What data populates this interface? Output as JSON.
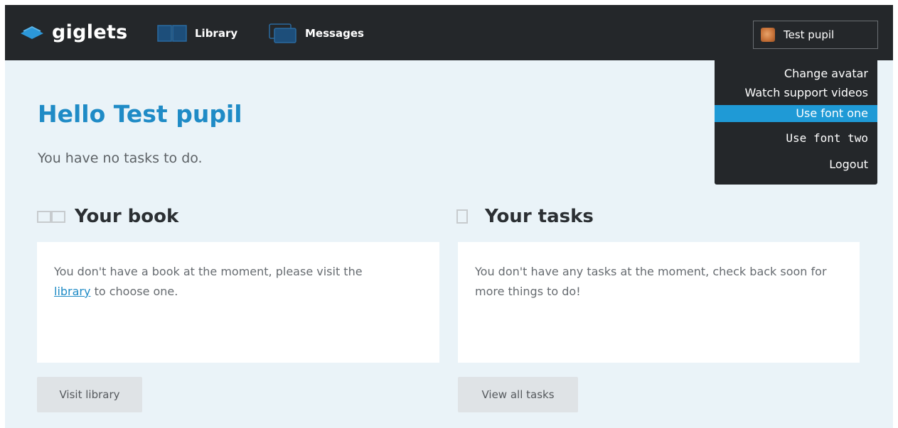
{
  "app": {
    "brand": "giglets"
  },
  "nav": {
    "library_label": "Library",
    "messages_label": "Messages"
  },
  "user": {
    "name": "Test pupil"
  },
  "user_menu": {
    "items": [
      {
        "label": "Change avatar"
      },
      {
        "label": "Watch support videos"
      },
      {
        "label": "Use font one",
        "highlighted": true
      },
      {
        "label": "Use font two"
      },
      {
        "label": "Logout"
      }
    ]
  },
  "main": {
    "greeting": "Hello Test pupil",
    "subtitle": "You have no tasks to do."
  },
  "book_section": {
    "title": "Your book",
    "text_before": "You don't have a book at the moment, please visit the",
    "link_text": "library",
    "text_after": " to choose one.",
    "button_label": "Visit library"
  },
  "tasks_section": {
    "title": "Your tasks",
    "text": "You don't have any tasks at the moment, check back soon for more things to do!",
    "button_label": "View all tasks"
  },
  "colors": {
    "topbar": "#24272a",
    "accent_blue": "#1f8bc6",
    "menu_highlight": "#1f9ad6",
    "page_background": "#eaf3f8"
  },
  "icons": {
    "brand": "giglets-logo-icon",
    "library": "book-icon",
    "messages": "messages-icon",
    "book_section": "open-book-icon",
    "tasks_section": "task-icon"
  }
}
